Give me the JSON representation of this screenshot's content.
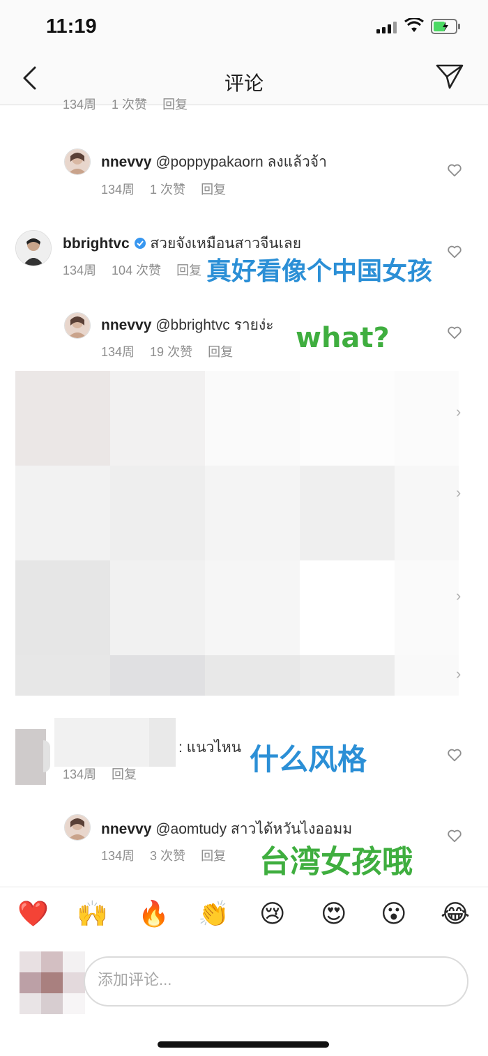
{
  "status_bar": {
    "time": "11:19"
  },
  "nav": {
    "title": "评论",
    "back_icon": "chevron-left-icon",
    "share_icon": "paper-plane-icon"
  },
  "comments": [
    {
      "username": "nnevvy",
      "text": "@poppypakaorn ลงแล้วจ้า",
      "time": "134周",
      "likes": "1 次赞",
      "reply": "回复"
    },
    {
      "username": "bbrightvc",
      "text": "สวยจังเหมือนสาวจีนเลย",
      "time": "134周",
      "likes": "104 次赞",
      "reply": "回复",
      "verified": true,
      "overlay": "真好看像个中国女孩"
    },
    {
      "username": "nnevvy",
      "text": "@bbrightvc รายง่ะ",
      "time": "134周",
      "likes": "19 次赞",
      "reply": "回复",
      "overlay": "what?"
    },
    {
      "username": "",
      "text": ": แนวไหน",
      "time": "134周",
      "reply": "回复",
      "overlay": "什么风格"
    },
    {
      "username": "nnevvy",
      "text": "@aomtudy สาวได้หวันไงออมม",
      "time": "134周",
      "likes": "3 次赞",
      "reply": "回复",
      "overlay": "台湾女孩哦"
    }
  ],
  "partial_top": {
    "time": "134周",
    "likes": "1 次赞",
    "reply": "回复"
  },
  "emoji_bar": [
    "❤️",
    "🙌",
    "🔥",
    "👏",
    "😢",
    "😍",
    "😮",
    "😂"
  ],
  "comment_input": {
    "placeholder": "添加评论..."
  },
  "colors": {
    "overlay_blue": "#2b8fd6",
    "overlay_green": "#3fae3f",
    "verified_blue": "#3897f0",
    "heart_red": "#ed4956"
  }
}
